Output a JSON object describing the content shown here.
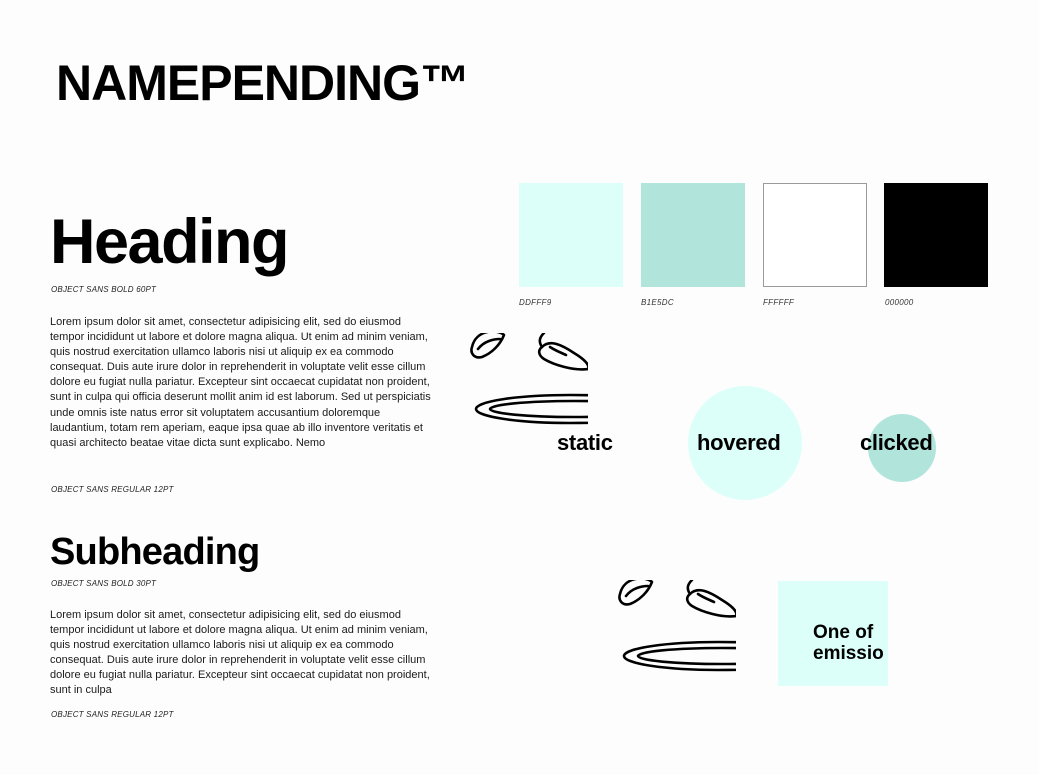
{
  "brand": {
    "name": "NAMEPENDING™"
  },
  "typography": {
    "heading": {
      "text": "Heading",
      "caption": "OBJECT SANS BOLD 60PT"
    },
    "body1": {
      "text": "Lorem ipsum dolor sit amet, consectetur adipisicing elit, sed do eiusmod tempor incididunt ut labore et dolore magna aliqua. Ut enim ad minim veniam, quis nostrud exercitation ullamco laboris nisi ut aliquip ex ea commodo consequat. Duis aute irure dolor in reprehenderit in voluptate velit esse cillum dolore eu fugiat nulla pariatur. Excepteur sint occaecat cupidatat non proident, sunt in culpa qui officia deserunt mollit anim id est laborum. Sed ut perspiciatis unde omnis iste natus error sit voluptatem accusantium doloremque laudantium, totam rem aperiam, eaque ipsa quae ab illo inventore veritatis et quasi architecto beatae vitae dicta sunt explicabo. Nemo",
      "caption": "OBJECT SANS REGULAR 12PT"
    },
    "subheading": {
      "text": "Subheading",
      "caption": "OBJECT SANS BOLD 30PT"
    },
    "body2": {
      "text": "Lorem ipsum dolor sit amet, consectetur adipisicing elit, sed do eiusmod tempor incididunt ut labore et dolore magna aliqua. Ut enim ad minim veniam, quis nostrud exercitation ullamco laboris nisi ut aliquip ex ea commodo consequat. Duis aute irure dolor in reprehenderit in voluptate velit esse cillum dolore eu fugiat nulla pariatur. Excepteur sint occaecat cupidatat non proident, sunt in culpa",
      "caption": "OBJECT SANS REGULAR 12PT"
    }
  },
  "palette": [
    {
      "hex": "DDFFF9",
      "color": "#DDFFF9"
    },
    {
      "hex": "B1E5DC",
      "color": "#B1E5DC"
    },
    {
      "hex": "FFFFFF",
      "color": "#FFFFFF"
    },
    {
      "hex": "000000",
      "color": "#000000"
    }
  ],
  "states": {
    "static": "static",
    "hovered": "hovered",
    "clicked": "clicked",
    "hover_color": "#DDFFF9",
    "click_color": "#B1E5DC"
  },
  "icons": {
    "illustration": "chili-pepper-plate-icon"
  },
  "card": {
    "line1": "One of",
    "line2": "emissio",
    "background": "#DDFFF9"
  }
}
